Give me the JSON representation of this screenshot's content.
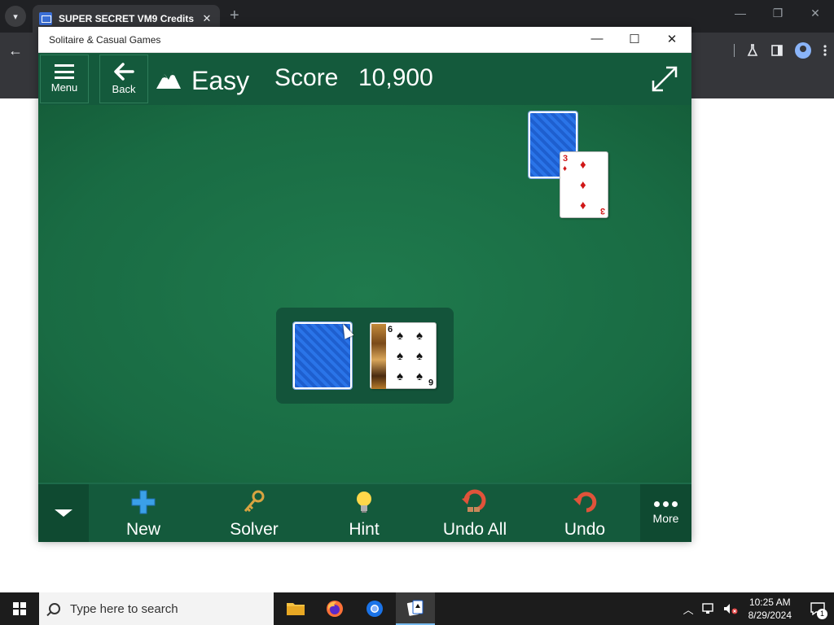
{
  "browser": {
    "tab_title": "SUPER SECRET VM9 Credits",
    "tab_close": "✕",
    "new_tab": "+",
    "minimize": "—",
    "restore": "❐",
    "close": "✕",
    "back": "←"
  },
  "app": {
    "window_title": "Solitaire & Casual Games",
    "minimize": "—",
    "maximize": "☐",
    "close": "✕"
  },
  "header": {
    "menu_label": "Menu",
    "back_label": "Back",
    "difficulty": "Easy",
    "score_label": "Score",
    "score_value": "10,900"
  },
  "cards": {
    "foundation_top": {
      "rank": "3",
      "suit": "♦"
    },
    "waste_top": {
      "rank": "6",
      "suit": "♠"
    }
  },
  "bottom_bar": {
    "new_label": "New",
    "solver_label": "Solver",
    "hint_label": "Hint",
    "undo_all_label": "Undo All",
    "undo_label": "Undo",
    "more_label": "More"
  },
  "taskbar": {
    "search_placeholder": "Type here to search",
    "time": "10:25 AM",
    "date": "8/29/2024",
    "notification_count": "1"
  },
  "colors": {
    "felt": "#1a6b4a",
    "header": "#145a3c",
    "card_back": "#2a74e8",
    "red_suit": "#d01818"
  }
}
